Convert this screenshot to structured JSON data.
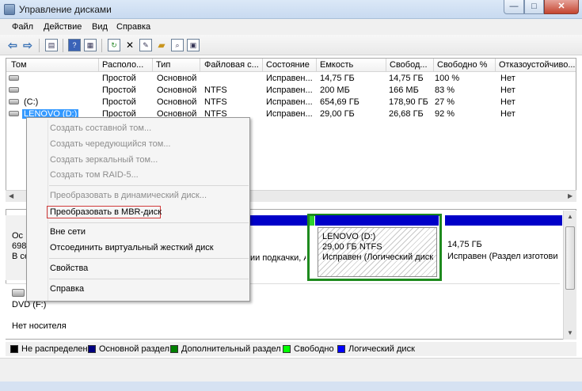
{
  "window": {
    "title": "Управление дисками",
    "min": "—",
    "max": "□",
    "close": "✕"
  },
  "menu": [
    "Файл",
    "Действие",
    "Вид",
    "Справка"
  ],
  "toolbar": {
    "icons": [
      "back-arrow",
      "forward-arrow",
      "properties",
      "help",
      "show-hide",
      "refresh",
      "rescan",
      "settings",
      "open",
      "search",
      "more"
    ]
  },
  "table": {
    "columns": [
      "Том",
      "Располо...",
      "Тип",
      "Файловая с...",
      "Состояние",
      "Емкость",
      "Свобод...",
      "Свободно %",
      "Отказоустойчиво..."
    ],
    "rows": [
      {
        "vol": "",
        "layout": "Простой",
        "type": "Основной",
        "fs": "",
        "status": "Исправен...",
        "capacity": "14,75 ГБ",
        "free": "14,75 ГБ",
        "pct": "100 %",
        "fault": "Нет"
      },
      {
        "vol": "",
        "layout": "Простой",
        "type": "Основной",
        "fs": "NTFS",
        "status": "Исправен...",
        "capacity": "200 МБ",
        "free": "166 МБ",
        "pct": "83 %",
        "fault": "Нет"
      },
      {
        "vol": "(C:)",
        "layout": "Простой",
        "type": "Основной",
        "fs": "NTFS",
        "status": "Исправен...",
        "capacity": "654,69 ГБ",
        "free": "178,90 ГБ",
        "pct": "27 %",
        "fault": "Нет"
      },
      {
        "vol": "LENOVO (D:)",
        "layout": "Простой",
        "type": "Основной",
        "fs": "NTFS",
        "status": "Исправен...",
        "capacity": "29,00 ГБ",
        "free": "26,68 ГБ",
        "pct": "92 %",
        "fault": "Нет"
      }
    ]
  },
  "disk": {
    "label_line1": "Ос",
    "label_line2": "698,",
    "label_line3": "В се",
    "partition_left_text": "ии подкачки, А",
    "partition_sel_name": "LENOVO  (D:)",
    "partition_sel_size": "29,00 ГБ NTFS",
    "partition_sel_status": "Исправен (Логический диск",
    "partition_right_size": "14,75 ГБ",
    "partition_right_status": "Исправен (Раздел изготови"
  },
  "dvd": {
    "name": "DVD (F:)",
    "status": "Нет носителя"
  },
  "legend": [
    {
      "label": "Не распределен",
      "color": "#000000"
    },
    {
      "label": "Основной раздел",
      "color": "#000080"
    },
    {
      "label": "Дополнительный раздел",
      "color": "#008000"
    },
    {
      "label": "Свободно",
      "color": "#00ff00"
    },
    {
      "label": "Логический диск",
      "color": "#0000ff"
    }
  ],
  "context_menu": {
    "items": [
      {
        "label": "Создать составной том...",
        "enabled": false
      },
      {
        "label": "Создать чередующийся том...",
        "enabled": false
      },
      {
        "label": "Создать зеркальный том...",
        "enabled": false
      },
      {
        "label": "Создать том RAID-5...",
        "enabled": false
      },
      {
        "label": "Преобразовать в динамический диск...",
        "enabled": false
      },
      {
        "label": "Преобразовать в MBR-диск",
        "enabled": true,
        "highlighted": true
      },
      {
        "label": "Вне сети",
        "enabled": true
      },
      {
        "label": "Отсоединить виртуальный жесткий диск",
        "enabled": true
      },
      {
        "label": "Свойства",
        "enabled": true
      },
      {
        "label": "Справка",
        "enabled": true
      }
    ]
  }
}
